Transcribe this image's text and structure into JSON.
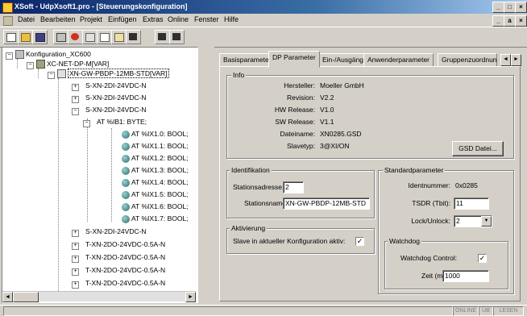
{
  "window": {
    "title": "XSoft - UdpXsoft1.pro - [Steuerungskonfiguration]",
    "outer_controls": [
      "_",
      "□",
      "×"
    ],
    "inner_controls": [
      "_",
      "a",
      "×"
    ]
  },
  "menu": [
    "Datei",
    "Bearbeiten",
    "Projekt",
    "Einfügen",
    "Extras",
    "Online",
    "Fenster",
    "Hilfe"
  ],
  "toolbar": {
    "buttons": [
      "new-icon",
      "open-icon",
      "save-icon",
      "compile-icon",
      "stop-icon",
      "cut-icon",
      "copy-icon",
      "paste-icon",
      "find-icon",
      "find-next-icon",
      "replace-icon"
    ]
  },
  "tree": {
    "root": "Konfiguration_XC600",
    "bus": "XC-NET-DP-M[VAR]",
    "gateway": "XN-GW-PBDP-12MB-STD[VAR]",
    "modules_a": [
      "S-XN-2DI-24VDC-N",
      "S-XN-2DI-24VDC-N",
      "S-XN-2DI-24VDC-N"
    ],
    "byte": "AT %IB1: BYTE;",
    "bits": [
      "AT %IX1.0: BOOL;",
      "AT %IX1.1: BOOL;",
      "AT %IX1.2: BOOL;",
      "AT %IX1.3: BOOL;",
      "AT %IX1.4: BOOL;",
      "AT %IX1.5: BOOL;",
      "AT %IX1.6: BOOL;",
      "AT %IX1.7: BOOL;"
    ],
    "modules_b": [
      "S-XN-2DI-24VDC-N",
      "T-XN-2DO-24VDC-0.5A-N",
      "T-XN-2DO-24VDC-0.5A-N",
      "T-XN-2DO-24VDC-0.5A-N",
      "T-XN-2DO-24VDC-0.5A-N"
    ]
  },
  "tabs": [
    "Basisparameter",
    "DP Parameter",
    "Ein-/Ausgänge",
    "Anwenderparameter",
    "Gruppenzuordnung"
  ],
  "info": {
    "label": "Info",
    "rows": [
      {
        "label": "Hersteller:",
        "value": "Moeller GmbH"
      },
      {
        "label": "Revision:",
        "value": "V2.2"
      },
      {
        "label": "HW Release:",
        "value": "V1.0"
      },
      {
        "label": "SW Release:",
        "value": "V1.1"
      },
      {
        "label": "Dateiname:",
        "value": "XN0285.GSD"
      },
      {
        "label": "Slavetyp:",
        "value": "3@XI/ON"
      }
    ],
    "gsd_button": "GSD Datei..."
  },
  "identifikation": {
    "label": "Identifikation",
    "station_addr_label": "Stationsadresse:",
    "station_addr_value": "2",
    "station_name_label": "Stationsname:",
    "station_name_value": "XN-GW-PBDP-12MB-STD"
  },
  "aktivierung": {
    "label": "Aktivierung",
    "slave_label": "Slave in aktueller Konfiguration aktiv:",
    "slave_checked": "✓"
  },
  "standard": {
    "label": "Standardparameter",
    "ident_label": "Identnummer:",
    "ident_value": "0x0285",
    "tsdr_label": "TSDR (Tbit):",
    "tsdr_value": "11",
    "lock_label": "Lock/Unlock:",
    "lock_value": "2"
  },
  "watchdog": {
    "label": "Watchdog",
    "control_label": "Watchdog Control:",
    "control_checked": "✓",
    "time_label": "Zeit (ms):",
    "time_value": "1000"
  },
  "status": [
    "ONLINE",
    "ÜB",
    "LESEN"
  ]
}
